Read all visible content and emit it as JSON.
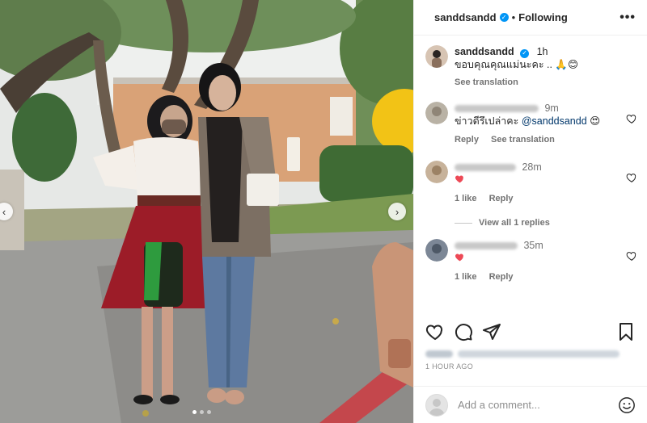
{
  "post": {
    "username": "sanddsandd",
    "follow_label": "Following",
    "separator": "•",
    "more_icon": "more-options-icon"
  },
  "photo": {
    "nav_left": "‹",
    "nav_right": "›",
    "slide_count": 3,
    "active_slide": 1
  },
  "caption": {
    "username": "sanddsandd",
    "time": "1h",
    "text": "ขอบคุณคุณแม่นะคะ .. 🙏😊",
    "see_translation": "See translation"
  },
  "comments": [
    {
      "text_prefix": "ข่าวดีรึเปล่าคะ ",
      "mention": "@sanddsandd",
      "emoji": "😍",
      "time": "9m",
      "reply": "Reply",
      "see_translation": "See translation"
    },
    {
      "time": "28m",
      "likes": "1 like",
      "reply": "Reply",
      "view_replies": "View all 1 replies"
    },
    {
      "time": "35m",
      "likes": "1 like",
      "reply": "Reply"
    }
  ],
  "footer": {
    "time_ago": "1 HOUR AGO",
    "add_comment_placeholder": "Add a comment..."
  },
  "colors": {
    "verified": "#0095f6",
    "heart": "#ed4956",
    "text": "#262626",
    "muted": "#737373"
  }
}
